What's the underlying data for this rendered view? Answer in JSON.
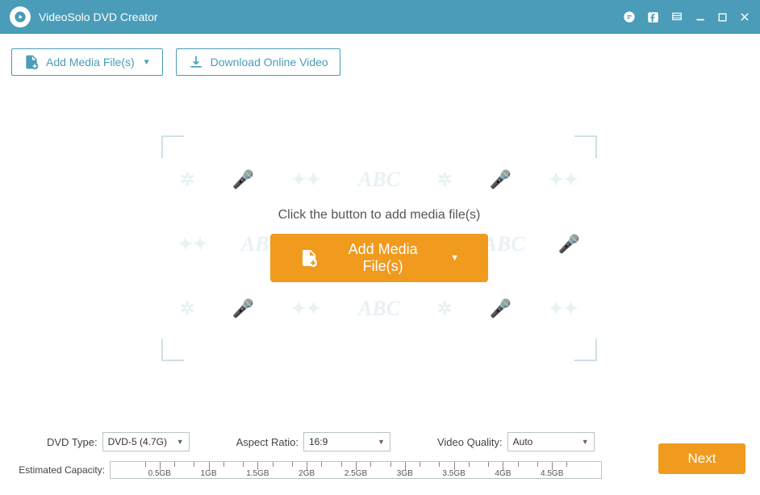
{
  "app": {
    "title": "VideoSolo DVD Creator"
  },
  "toolbar": {
    "add_media": "Add Media File(s)",
    "download_video": "Download Online Video"
  },
  "drop": {
    "instruction": "Click the button to add media file(s)",
    "add_media": "Add Media File(s)"
  },
  "options": {
    "dvd_type_label": "DVD Type:",
    "dvd_type_value": "DVD-5 (4.7G)",
    "aspect_ratio_label": "Aspect Ratio:",
    "aspect_ratio_value": "16:9",
    "video_quality_label": "Video Quality:",
    "video_quality_value": "Auto"
  },
  "capacity": {
    "label": "Estimated Capacity:",
    "ticks": [
      "0.5GB",
      "1GB",
      "1.5GB",
      "2GB",
      "2.5GB",
      "3GB",
      "3.5GB",
      "4GB",
      "4.5GB"
    ]
  },
  "footer": {
    "next": "Next"
  },
  "colors": {
    "accent_teal": "#4a9cb8",
    "accent_orange": "#f09a1e"
  }
}
